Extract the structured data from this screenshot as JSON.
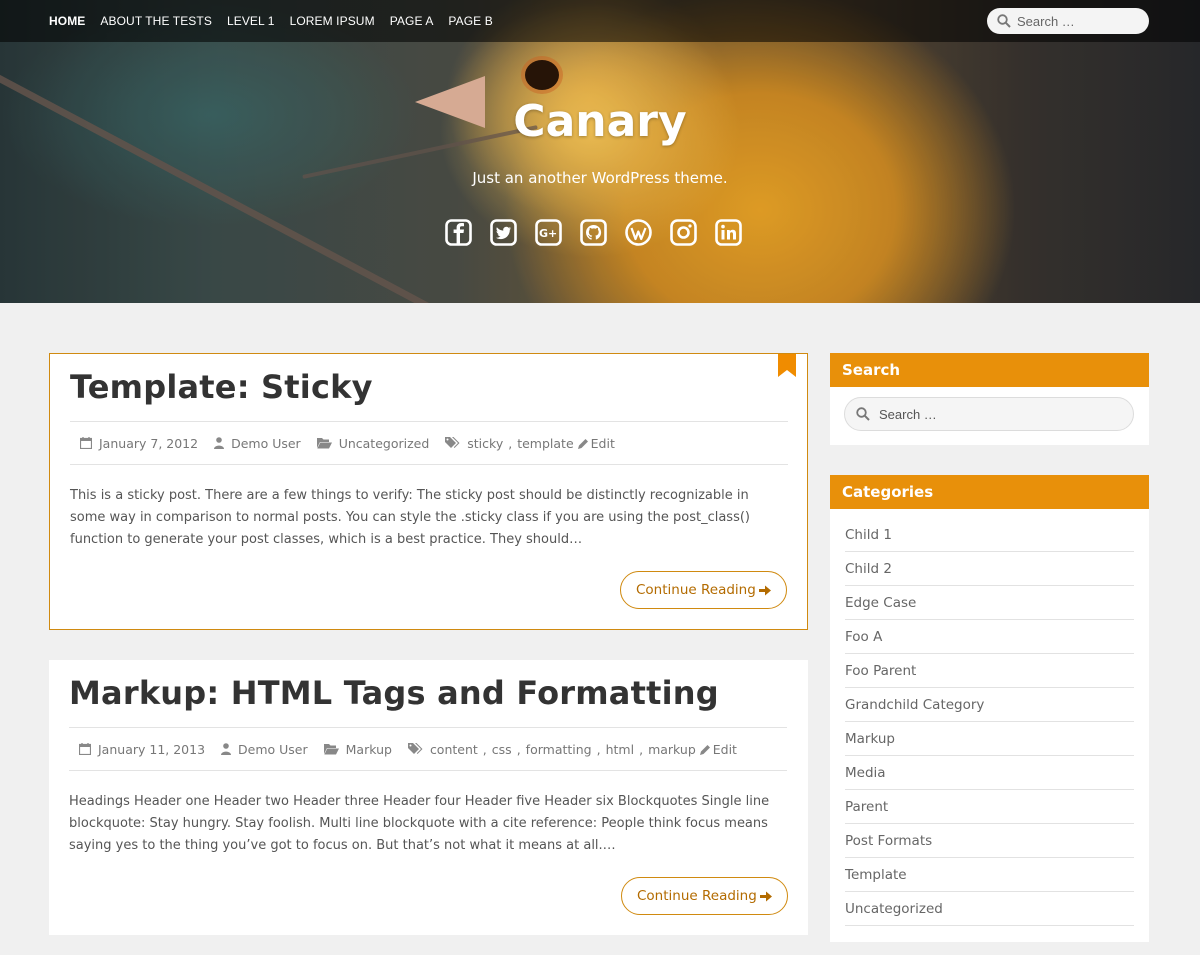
{
  "nav": {
    "items": [
      {
        "label": "HOME",
        "active": true
      },
      {
        "label": "ABOUT THE TESTS",
        "active": false
      },
      {
        "label": "LEVEL 1",
        "active": false
      },
      {
        "label": "LOREM IPSUM",
        "active": false
      },
      {
        "label": "PAGE A",
        "active": false
      },
      {
        "label": "PAGE B",
        "active": false
      }
    ],
    "search_placeholder": "Search …"
  },
  "header": {
    "title": "Canary",
    "tagline": "Just an another WordPress theme.",
    "social_icons": [
      "facebook-icon",
      "twitter-icon",
      "google-plus-icon",
      "github-icon",
      "wordpress-icon",
      "instagram-icon",
      "linkedin-icon"
    ]
  },
  "posts": [
    {
      "title": "Template: Sticky",
      "date": "January 7, 2012",
      "author": "Demo User",
      "category": "Uncategorized",
      "tags": [
        "sticky",
        "template"
      ],
      "edit_label": "Edit",
      "excerpt": "This is a sticky post. There are a few things to verify: The sticky post should be distinctly recognizable in some way in comparison to normal posts. You can style the .sticky class if you are using the post_class() function to generate your post classes, which is a best practice. They should…",
      "continue_label": "Continue Reading",
      "sticky": true
    },
    {
      "title": "Markup: HTML Tags and Formatting",
      "date": "January 11, 2013",
      "author": "Demo User",
      "category": "Markup",
      "tags": [
        "content",
        "css",
        "formatting",
        "html",
        "markup"
      ],
      "edit_label": "Edit",
      "excerpt": "Headings Header one Header two Header three Header four Header five Header six Blockquotes Single line blockquote: Stay hungry. Stay foolish. Multi line blockquote with a cite reference: People think focus means saying yes to the thing you’ve got to focus on. But that’s not what it means at all.…",
      "continue_label": "Continue Reading",
      "sticky": false
    }
  ],
  "sidebar": {
    "search": {
      "title": "Search",
      "placeholder": "Search …"
    },
    "categories": {
      "title": "Categories",
      "items": [
        "Child 1",
        "Child 2",
        "Edge Case",
        "Foo A",
        "Foo Parent",
        "Grandchild Category",
        "Markup",
        "Media",
        "Parent",
        "Post Formats",
        "Template",
        "Uncategorized"
      ]
    }
  },
  "colors": {
    "accent": "#e8900a",
    "accent_dark": "#d08a10",
    "nav_bg": "#3a3a3a"
  }
}
